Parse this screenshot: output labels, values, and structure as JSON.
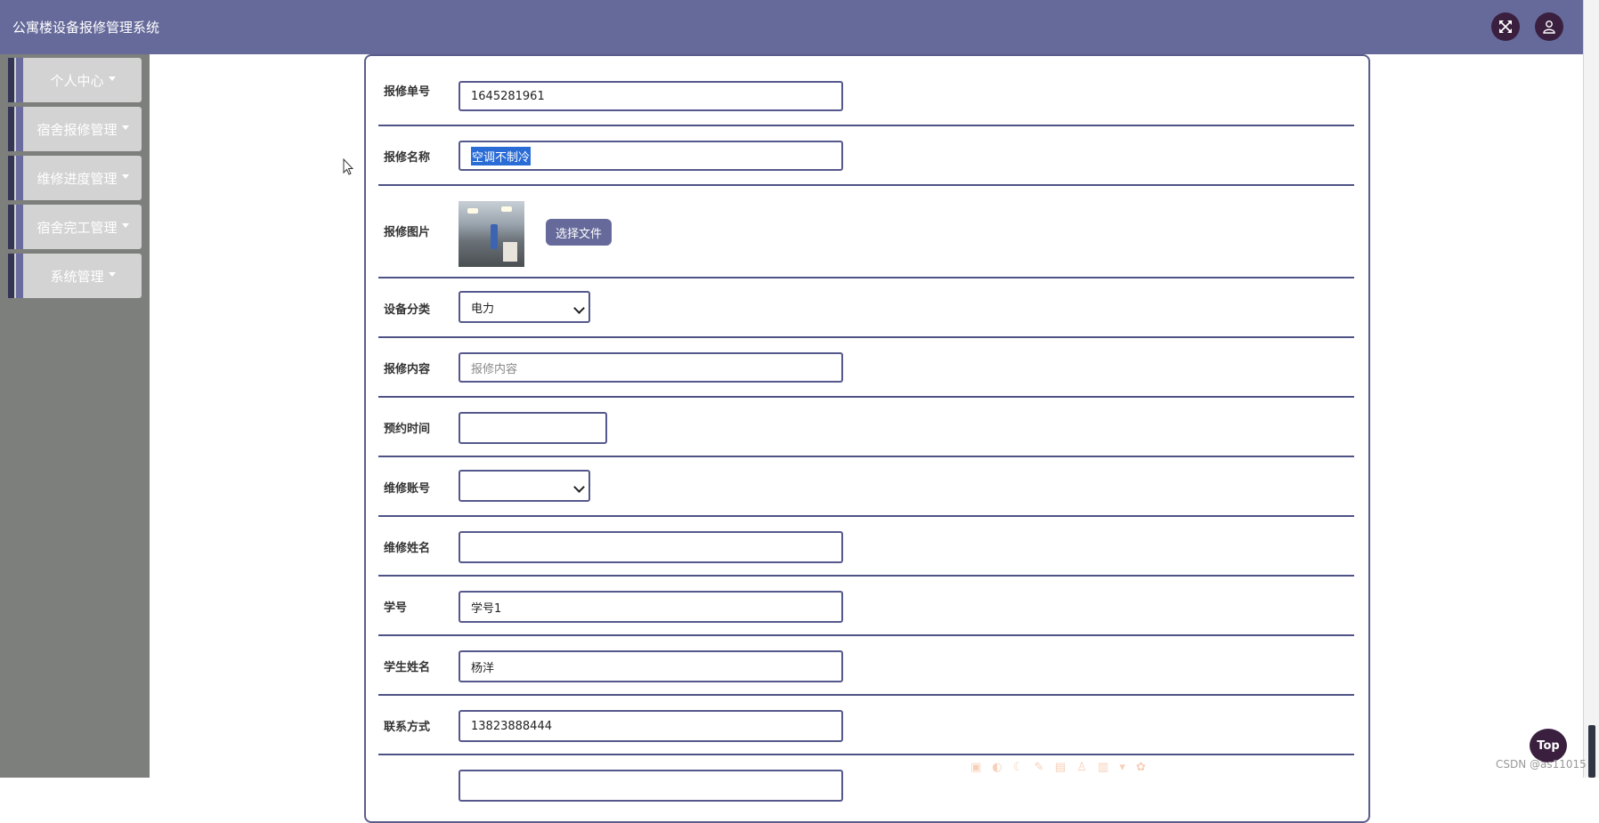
{
  "header": {
    "app_title": "公寓楼设备报修管理系统",
    "fullscreen_icon": "expand-icon",
    "user_icon": "user-icon"
  },
  "sidebar": {
    "items": [
      {
        "label": "个人中心"
      },
      {
        "label": "宿舍报修管理"
      },
      {
        "label": "维修进度管理"
      },
      {
        "label": "宿舍完工管理"
      },
      {
        "label": "系统管理"
      }
    ]
  },
  "form": {
    "repair_no": {
      "label": "报修单号",
      "value": "1645281961"
    },
    "repair_name": {
      "label": "报修名称",
      "value": "空调不制冷"
    },
    "repair_image": {
      "label": "报修图片",
      "button_label": "选择文件"
    },
    "device_category": {
      "label": "设备分类",
      "selected": "电力"
    },
    "repair_content": {
      "label": "报修内容",
      "placeholder": "报修内容"
    },
    "appointment_time": {
      "label": "预约时间",
      "value": ""
    },
    "repair_account": {
      "label": "维修账号",
      "selected": ""
    },
    "repair_person_name": {
      "label": "维修姓名",
      "value": ""
    },
    "student_id": {
      "label": "学号",
      "value": "学号1"
    },
    "student_name": {
      "label": "学生姓名",
      "value": "杨洋"
    },
    "contact": {
      "label": "联系方式",
      "value": "13823888444"
    }
  },
  "top_button": {
    "label": "Top"
  },
  "watermark": "CSDN @as11015",
  "colors": {
    "header_bg": "#666a9a",
    "sidebar_bg": "#7d7f7c",
    "accent_dark": "#3a1f3f",
    "input_border": "#55588c"
  }
}
